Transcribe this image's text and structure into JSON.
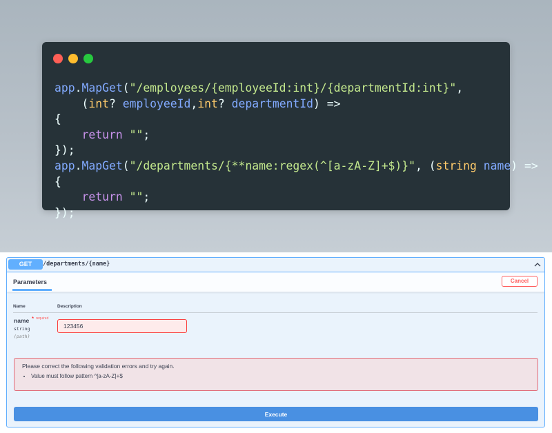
{
  "code_card": {
    "window_dots": [
      "red",
      "yellow",
      "green"
    ],
    "colors": {
      "background": "#263238",
      "keyword": "#c792ea",
      "function": "#82aaff",
      "string": "#c3e88d",
      "type": "#ffcb6b",
      "text": "#eeffff"
    },
    "lines": [
      [
        {
          "c": "obj",
          "t": "app"
        },
        {
          "c": "punc",
          "t": "."
        },
        {
          "c": "fn",
          "t": "MapGet"
        },
        {
          "c": "punc",
          "t": "("
        },
        {
          "c": "str",
          "t": "\"/employees/{employeeId:int}/{departmentId:int}\""
        },
        {
          "c": "punc",
          "t": ","
        }
      ],
      [
        {
          "c": "punc",
          "t": "    ("
        },
        {
          "c": "type",
          "t": "int"
        },
        {
          "c": "punc",
          "t": "? "
        },
        {
          "c": "param",
          "t": "employeeId"
        },
        {
          "c": "punc",
          "t": ","
        },
        {
          "c": "type",
          "t": "int"
        },
        {
          "c": "punc",
          "t": "? "
        },
        {
          "c": "param",
          "t": "departmentId"
        },
        {
          "c": "punc",
          "t": ") =>"
        }
      ],
      [
        {
          "c": "punc",
          "t": "{"
        }
      ],
      [
        {
          "c": "punc",
          "t": "    "
        },
        {
          "c": "kw",
          "t": "return"
        },
        {
          "c": "punc",
          "t": " "
        },
        {
          "c": "str",
          "t": "\"\""
        },
        {
          "c": "punc",
          "t": ";"
        }
      ],
      [
        {
          "c": "punc",
          "t": "});"
        }
      ],
      [
        {
          "c": "obj",
          "t": "app"
        },
        {
          "c": "punc",
          "t": "."
        },
        {
          "c": "fn",
          "t": "MapGet"
        },
        {
          "c": "punc",
          "t": "("
        },
        {
          "c": "str",
          "t": "\"/departments/{**name:regex(^[a-zA-Z]+$)}\""
        },
        {
          "c": "punc",
          "t": ", ("
        },
        {
          "c": "type",
          "t": "string"
        },
        {
          "c": "punc",
          "t": " "
        },
        {
          "c": "param",
          "t": "name"
        },
        {
          "c": "punc",
          "t": ") =>"
        }
      ],
      [
        {
          "c": "punc",
          "t": "{"
        }
      ],
      [
        {
          "c": "punc",
          "t": "    "
        },
        {
          "c": "kw",
          "t": "return"
        },
        {
          "c": "punc",
          "t": " "
        },
        {
          "c": "str",
          "t": "\"\""
        },
        {
          "c": "punc",
          "t": ";"
        }
      ],
      [
        {
          "c": "punc",
          "t": "});"
        }
      ]
    ]
  },
  "operation": {
    "method": "GET",
    "path": "/departments/{name}",
    "accent_color": "#61affe",
    "collapse_icon": "chevron-up-icon"
  },
  "parameters": {
    "tab_label": "Parameters",
    "cancel_label": "Cancel",
    "col_name": "Name",
    "col_description": "Description",
    "param": {
      "name": "name",
      "required_mark": "*",
      "required_label": "required",
      "type": "string",
      "in": "(path)",
      "value": "123456"
    }
  },
  "validation": {
    "message": "Please correct the following validation errors and try again.",
    "errors": [
      "Value must follow pattern ^[a-zA-Z]+$"
    ],
    "border_color": "#e06a78"
  },
  "execute": {
    "label": "Execute",
    "color": "#4990e2"
  }
}
